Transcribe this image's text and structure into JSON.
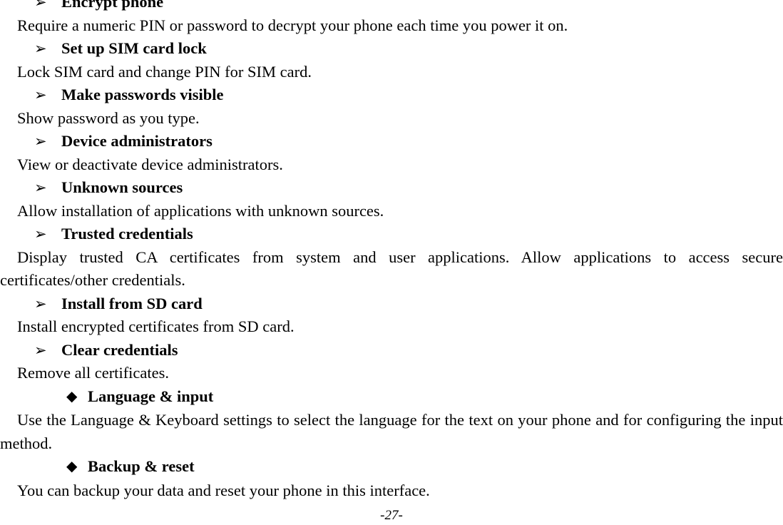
{
  "page": {
    "footer_page_number": "-27-",
    "text_color": "#000000",
    "background_color": "#ffffff"
  },
  "bullets": {
    "arrow": "➢",
    "diamond": "◆"
  },
  "sections": [
    {
      "bullet_type": "arrow",
      "heading": "Encrypt phone",
      "body": "Require a numeric PIN or password to decrypt your phone each time you power it on.",
      "justified": false
    },
    {
      "bullet_type": "arrow",
      "heading": "Set up SIM card lock",
      "body": "Lock SIM card and change PIN for SIM card.",
      "justified": false
    },
    {
      "bullet_type": "arrow",
      "heading": "Make passwords visible",
      "body": "Show password as you type.",
      "justified": false
    },
    {
      "bullet_type": "arrow",
      "heading": "Device administrators",
      "body": "View or deactivate device administrators.",
      "justified": false
    },
    {
      "bullet_type": "arrow",
      "heading": "Unknown sources",
      "body": "Allow installation of applications with unknown sources.",
      "justified": false
    },
    {
      "bullet_type": "arrow",
      "heading": "Trusted credentials",
      "body": "Display trusted CA certificates from system and user applications. Allow applications to access secure certificates/other credentials.",
      "justified": true
    },
    {
      "bullet_type": "arrow",
      "heading": "Install from SD card",
      "body": "Install encrypted certificates from SD card.",
      "justified": false
    },
    {
      "bullet_type": "arrow",
      "heading": "Clear credentials",
      "body": "Remove all certificates.",
      "justified": false
    },
    {
      "bullet_type": "diamond",
      "heading": "Language & input",
      "body": "Use the Language & Keyboard settings to select the language for the text on your phone and for configuring the input method.",
      "justified": true
    },
    {
      "bullet_type": "diamond",
      "heading": "Backup & reset",
      "body": "You can backup your data and reset your phone in this interface.",
      "justified": false
    }
  ]
}
